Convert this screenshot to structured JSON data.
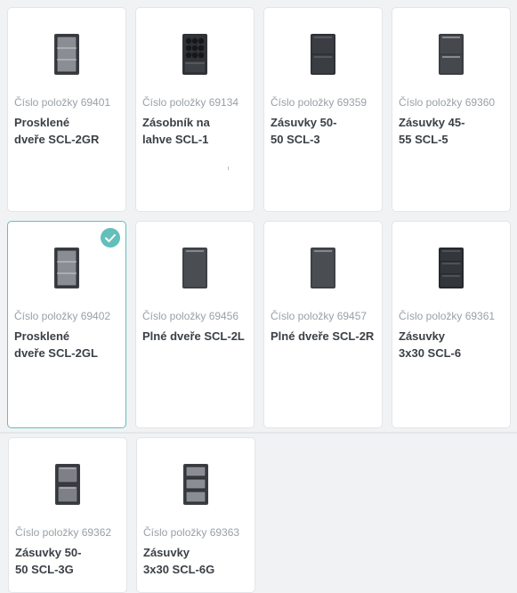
{
  "products": [
    {
      "number": "Číslo položky 69401",
      "title_line1": "Prosklené",
      "title_line2": "dveře SCL-2GR",
      "icon": "glass-door-cabinet-icon",
      "selected": false
    },
    {
      "number": "Číslo položky 69134",
      "title_line1": "Zásobník na",
      "title_line2": "lahve SCL-1",
      "icon": "bottle-rack-cabinet-icon",
      "selected": false
    },
    {
      "number": "Číslo položky 69359",
      "title_line1": "Zásuvky 50-",
      "title_line2": "50 SCL-3",
      "icon": "two-drawer-cabinet-icon",
      "selected": false
    },
    {
      "number": "Číslo položky 69360",
      "title_line1": "Zásuvky 45-",
      "title_line2": "55 SCL-5",
      "icon": "two-drawer-cabinet-icon",
      "selected": false
    },
    {
      "number": "Číslo položky 69402",
      "title_line1": "Prosklené",
      "title_line2": "dveře SCL-2GL",
      "icon": "glass-door-cabinet-icon",
      "selected": true
    },
    {
      "number": "Číslo položky 69456",
      "title_line1": "Plné dveře SCL-2L",
      "title_line2": "",
      "icon": "solid-door-cabinet-icon",
      "selected": false
    },
    {
      "number": "Číslo položky 69457",
      "title_line1": "Plné dveře SCL-2R",
      "title_line2": "",
      "icon": "solid-door-cabinet-icon",
      "selected": false
    },
    {
      "number": "Číslo položky 69361",
      "title_line1": "Zásuvky",
      "title_line2": "3x30 SCL-6",
      "icon": "three-drawer-cabinet-icon",
      "selected": false
    },
    {
      "number": "Číslo položky 69362",
      "title_line1": "Zásuvky 50-",
      "title_line2": "50 SCL-3G",
      "icon": "glass-drawer-cabinet-icon",
      "selected": false
    },
    {
      "number": "Číslo položky 69363",
      "title_line1": "Zásuvky",
      "title_line2": "3x30 SCL-6G",
      "icon": "glass-three-drawer-cabinet-icon",
      "selected": false
    }
  ],
  "colors": {
    "accent": "#63bfb9",
    "cabinet_dark": "#2f3236",
    "cabinet_mid": "#4a4e53",
    "glass": "#8f9399"
  }
}
